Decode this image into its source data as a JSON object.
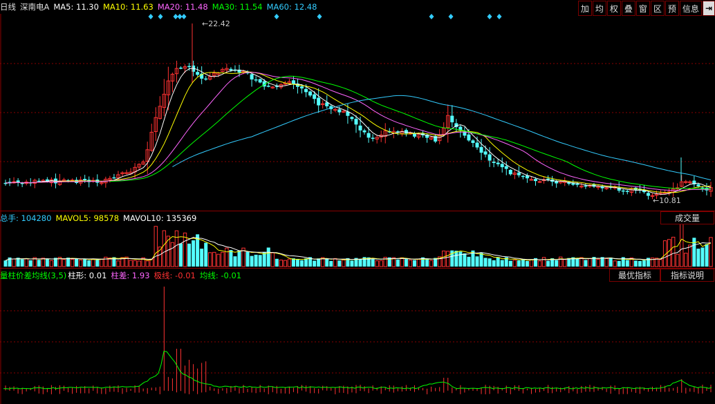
{
  "colors": {
    "up": "#ff3232",
    "down": "#54ffff",
    "ma5": "#ffffff",
    "ma10": "#ffff00",
    "ma20": "#ff66ff",
    "ma30": "#00ff00",
    "ma60": "#33ccff",
    "grid": "#8b0000"
  },
  "header": {
    "period": "日线",
    "stock_name": "深南电A",
    "ma5": "MA5: 11.30",
    "ma10": "MA10: 11.63",
    "ma20": "MA20: 11.48",
    "ma30": "MA30: 11.54",
    "ma60": "MA60: 12.48"
  },
  "toolbar": [
    {
      "label": "加",
      "icon": "add"
    },
    {
      "label": "均",
      "icon": "average"
    },
    {
      "label": "权",
      "icon": "rights"
    },
    {
      "label": "叠",
      "icon": "overlay"
    },
    {
      "label": "窗",
      "icon": "window"
    },
    {
      "label": "区",
      "icon": "range"
    },
    {
      "label": "预",
      "icon": "preview"
    },
    {
      "label": "信息",
      "icon": "info"
    },
    {
      "label": "⇥",
      "icon": "arrow-right-icon"
    }
  ],
  "annotations": {
    "high": "22.42",
    "low": "10.81"
  },
  "volume": {
    "total": "总手: 104280",
    "mavol5": "MAVOL5: 98578",
    "mavol10": "MAVOL10: 135369",
    "button": "成交量"
  },
  "indicator": {
    "title": "量柱价差均线(3,5)",
    "bar": "柱形: 0.01",
    "diff": "柱差: 1.93",
    "pole": "极线: -0.01",
    "avg": "均线: -0.01",
    "best_button": "最优指标",
    "explain_button": "指标说明"
  },
  "chart_data": {
    "type": "candlestick",
    "price_range": [
      10.81,
      22.42
    ],
    "high_label": 22.42,
    "low_label": 10.81,
    "ma_legend": {
      "MA5": 11.3,
      "MA10": 11.63,
      "MA20": 11.48,
      "MA30": 11.54,
      "MA60": 12.48
    },
    "volume_legend": {
      "total": 104280,
      "MAVOL5": 98578,
      "MAVOL10": 135369
    }
  }
}
